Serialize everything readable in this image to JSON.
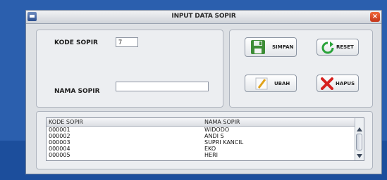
{
  "window": {
    "title": "INPUT DATA SOPIR",
    "close_glyph": "×"
  },
  "form": {
    "kode_label": "KODE SOPIR",
    "kode_value": "7",
    "nama_label": "NAMA SOPIR",
    "nama_value": ""
  },
  "buttons": {
    "simpan": {
      "label": "SIMPAN",
      "icon": "floppy-disk-icon"
    },
    "reset": {
      "label": "RESET",
      "icon": "refresh-icon"
    },
    "ubah": {
      "label": "UBAH",
      "icon": "pencil-icon"
    },
    "hapus": {
      "label": "HAPUS",
      "icon": "delete-x-icon"
    }
  },
  "table": {
    "columns": [
      "KODE SOPIR",
      "NAMA SOPIR"
    ],
    "rows": [
      [
        "000001",
        "WIDODO"
      ],
      [
        "000002",
        "ANDI S"
      ],
      [
        "000003",
        "SUPRI KANCIL"
      ],
      [
        "000004",
        "EKO"
      ],
      [
        "000005",
        "HERI"
      ]
    ]
  },
  "colors": {
    "desktop": "#2b5fae",
    "close": "#d9431f",
    "reset_green": "#2aa33a",
    "hapus_red": "#d6201e"
  }
}
